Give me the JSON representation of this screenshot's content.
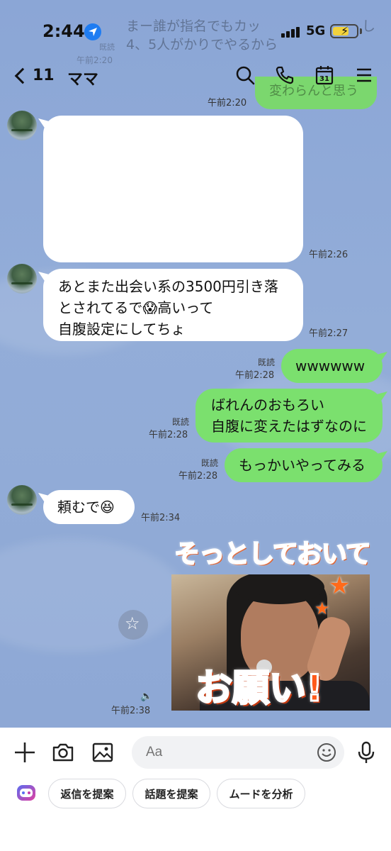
{
  "status_bar": {
    "time": "2:44",
    "network": "5G"
  },
  "notification": {
    "line1": "まー誰が指名でもカッ",
    "line1_tail": "し",
    "line2": "4、5人がかりでやるから",
    "time": "午前2:20",
    "badge": "既読"
  },
  "header": {
    "back_count": "11",
    "title": "ママ",
    "calendar_day": "31"
  },
  "previous": {
    "text": "変わらんと思う",
    "time": "午前2:20"
  },
  "messages": [
    {
      "id": "m1",
      "side": "in",
      "text": "",
      "time": "午前2:26"
    },
    {
      "id": "m2",
      "side": "in",
      "lines": [
        "あとまた出会い系の3500円引き落",
        "とされてるで😱高いって",
        "自腹設定にしてちょ"
      ],
      "time": "午前2:27"
    },
    {
      "id": "m3",
      "side": "out",
      "text": "wwwwww",
      "read": "既読",
      "time": "午前2:28"
    },
    {
      "id": "m4",
      "side": "out",
      "lines": [
        "ばれんのおもろい",
        "自腹に変えたはずなのに"
      ],
      "read": "既読",
      "time": "午前2:28"
    },
    {
      "id": "m5",
      "side": "out",
      "text": "もっかいやってみる",
      "read": "既読",
      "time": "午前2:28"
    },
    {
      "id": "m6",
      "side": "in",
      "text": "頼むで😆",
      "time": "午前2:34"
    },
    {
      "id": "m7",
      "side": "out",
      "sticker_top": "そっとしておいて",
      "sticker_bottom": "お願い!",
      "time": "午前2:38"
    }
  ],
  "input": {
    "placeholder": "Aa"
  },
  "suggestions": [
    {
      "label": "返信を提案"
    },
    {
      "label": "話題を提案"
    },
    {
      "label": "ムードを分析"
    }
  ],
  "colors": {
    "chat_background": "#8FA9D6",
    "outgoing_bubble": "#7BE06E",
    "incoming_bubble": "#FFFFFF",
    "location_icon": "#1E7CF2"
  },
  "icons": {
    "status": [
      "location-arrow-icon",
      "signal-icon",
      "battery-charging-icon"
    ],
    "header": [
      "chevron-left-icon",
      "search-icon",
      "phone-icon",
      "calendar-icon",
      "menu-icon"
    ],
    "input_bar": [
      "plus-icon",
      "camera-icon",
      "image-icon",
      "emoji-icon",
      "microphone-icon",
      "ai-assistant-icon"
    ],
    "chat": [
      "star-icon",
      "speaker-icon"
    ]
  }
}
